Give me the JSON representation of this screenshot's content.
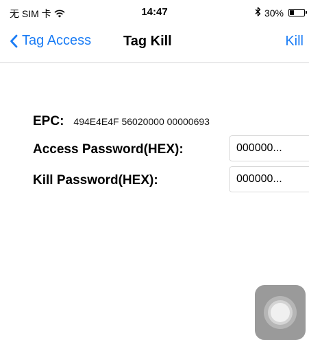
{
  "status_bar": {
    "carrier": "无 SIM 卡",
    "time": "14:47",
    "battery": "30%",
    "battery_level": 0.3
  },
  "nav": {
    "back_label": "Tag Access",
    "title": "Tag Kill",
    "action_label": "Kill"
  },
  "form": {
    "epc_label": "EPC:",
    "epc_value": "494E4E4F 56020000 00000693",
    "access_password_label": "Access Password(HEX):",
    "access_password_value": "000000...",
    "kill_password_label": "Kill Password(HEX):",
    "kill_password_value": "000000..."
  },
  "colors": {
    "accent": "#1a7cf5",
    "separator": "#d3d3d6"
  }
}
